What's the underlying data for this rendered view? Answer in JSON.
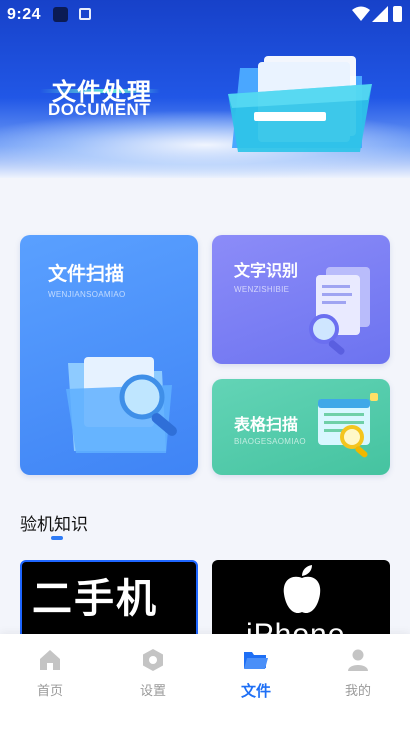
{
  "status_bar": {
    "time": "9:24"
  },
  "banner": {
    "title": "文件处理",
    "subtitle": "DOCUMENT"
  },
  "cards": {
    "scan": {
      "title": "文件扫描",
      "pinyin": "WENJIANSOAMIAO"
    },
    "text": {
      "title": "文字识别",
      "pinyin": "WENZISHIBIE"
    },
    "table": {
      "title": "表格扫描",
      "pinyin": "BIAOGESAOMIAO"
    }
  },
  "section": {
    "title": "验机知识",
    "thumbs": [
      {
        "text": "二手机"
      },
      {
        "text": "iPhone"
      }
    ]
  },
  "nav": {
    "items": [
      {
        "label": "首页",
        "icon": "home-icon"
      },
      {
        "label": "设置",
        "icon": "settings-hexagon-icon"
      },
      {
        "label": "文件",
        "icon": "folder-icon"
      },
      {
        "label": "我的",
        "icon": "person-icon"
      }
    ],
    "active": "文件"
  },
  "colors": {
    "accent": "#1e6ff5",
    "banner": "#2157e6",
    "scan_card": "#4a8ef8",
    "text_card": "#7b80f4",
    "table_card": "#52caa9"
  }
}
